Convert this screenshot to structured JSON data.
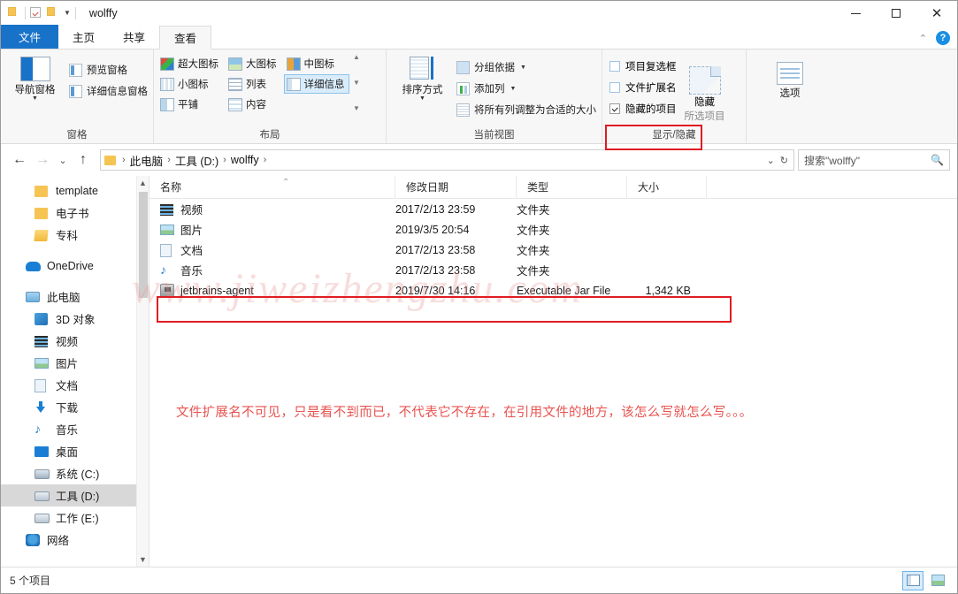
{
  "window": {
    "title": "wolffy",
    "quick_access": [
      "folder-icon",
      "checkbox-icon",
      "folder-icon",
      "dropdown-caret"
    ],
    "minimize": "minimize-icon",
    "maximize": "maximize-icon",
    "close": "close-icon"
  },
  "tabs": [
    {
      "label": "文件",
      "kind": "file"
    },
    {
      "label": "主页",
      "kind": "normal"
    },
    {
      "label": "共享",
      "kind": "normal"
    },
    {
      "label": "查看",
      "kind": "active"
    }
  ],
  "tab_right": {
    "collapse": "⌃",
    "help": "?"
  },
  "ribbon": {
    "groups": [
      {
        "label": "窗格",
        "big_button": {
          "label": "导航窗格",
          "has_dropdown": true
        },
        "items": [
          {
            "label": "预览窗格"
          },
          {
            "label": "详细信息窗格"
          }
        ]
      },
      {
        "label": "布局",
        "views": [
          {
            "label": "超大图标",
            "selected": false
          },
          {
            "label": "大图标",
            "selected": false
          },
          {
            "label": "中图标",
            "selected": false
          },
          {
            "label": "小图标",
            "selected": false
          },
          {
            "label": "列表",
            "selected": false
          },
          {
            "label": "详细信息",
            "selected": true
          },
          {
            "label": "平铺",
            "selected": false
          },
          {
            "label": "内容",
            "selected": false
          }
        ]
      },
      {
        "label": "当前视图",
        "big_button": {
          "label": "排序方式",
          "has_dropdown": true
        },
        "items": [
          {
            "label": "分组依据",
            "has_dropdown": true
          },
          {
            "label": "添加列",
            "has_dropdown": true
          },
          {
            "label": "将所有列调整为合适的大小",
            "has_dropdown": false
          }
        ]
      },
      {
        "label": "显示/隐藏",
        "checkboxes": [
          {
            "label": "项目复选框",
            "checked": false,
            "highlighted": false
          },
          {
            "label": "文件扩展名",
            "checked": false,
            "highlighted": true
          },
          {
            "label": "隐藏的项目",
            "checked": true,
            "highlighted": false
          }
        ],
        "hide_button": {
          "line1": "隐藏",
          "line2": "所选项目"
        }
      },
      {
        "label": "",
        "options_button": {
          "label": "选项"
        }
      }
    ]
  },
  "address_bar": {
    "back": "←",
    "forward": "→",
    "history": "⌄",
    "up": "↑",
    "breadcrumb": [
      {
        "text": "此电脑"
      },
      {
        "text": "工具 (D:)"
      },
      {
        "text": "wolffy"
      }
    ],
    "dropdown": "⌄",
    "refresh": "↻",
    "search_placeholder": "搜索\"wolffy\"",
    "search_value": "",
    "search_icon": "search-icon"
  },
  "sidebar": {
    "items": [
      {
        "label": "template",
        "icon": "folder-icon",
        "level": 2,
        "selected": false
      },
      {
        "label": "电子书",
        "icon": "folder-icon",
        "level": 2,
        "selected": false
      },
      {
        "label": "专科",
        "icon": "folder-open-icon",
        "level": 2,
        "selected": false
      },
      {
        "label": "",
        "icon": "spacer",
        "level": 0,
        "selected": false
      },
      {
        "label": "OneDrive",
        "icon": "cloud-icon",
        "level": 1,
        "selected": false
      },
      {
        "label": "",
        "icon": "spacer",
        "level": 0,
        "selected": false
      },
      {
        "label": "此电脑",
        "icon": "this-pc-icon",
        "level": 1,
        "selected": false
      },
      {
        "label": "3D 对象",
        "icon": "3d-objects-icon",
        "level": 2,
        "selected": false
      },
      {
        "label": "视频",
        "icon": "video-icon",
        "level": 2,
        "selected": false
      },
      {
        "label": "图片",
        "icon": "picture-icon",
        "level": 2,
        "selected": false
      },
      {
        "label": "文档",
        "icon": "document-icon",
        "level": 2,
        "selected": false
      },
      {
        "label": "下载",
        "icon": "download-icon",
        "level": 2,
        "selected": false
      },
      {
        "label": "音乐",
        "icon": "music-icon",
        "level": 2,
        "selected": false
      },
      {
        "label": "桌面",
        "icon": "desktop-icon",
        "level": 2,
        "selected": false
      },
      {
        "label": "系统 (C:)",
        "icon": "drive-icon",
        "level": 2,
        "selected": false
      },
      {
        "label": "工具 (D:)",
        "icon": "drive-icon",
        "level": 2,
        "selected": true
      },
      {
        "label": "工作 (E:)",
        "icon": "drive-icon",
        "level": 2,
        "selected": false
      },
      {
        "label": "网络",
        "icon": "network-icon",
        "level": 1,
        "selected": false
      }
    ]
  },
  "file_list": {
    "columns": [
      {
        "label": "名称",
        "key": "name"
      },
      {
        "label": "修改日期",
        "key": "date"
      },
      {
        "label": "类型",
        "key": "type"
      },
      {
        "label": "大小",
        "key": "size"
      }
    ],
    "sort_indicator": "⌃",
    "rows": [
      {
        "name": "视频",
        "date": "2017/2/13 23:59",
        "type": "文件夹",
        "size": "",
        "icon": "video-icon",
        "highlighted": false
      },
      {
        "name": "图片",
        "date": "2019/3/5 20:54",
        "type": "文件夹",
        "size": "",
        "icon": "picture-icon",
        "highlighted": false
      },
      {
        "name": "文档",
        "date": "2017/2/13 23:58",
        "type": "文件夹",
        "size": "",
        "icon": "document-icon",
        "highlighted": false
      },
      {
        "name": "音乐",
        "date": "2017/2/13 23:58",
        "type": "文件夹",
        "size": "",
        "icon": "music-icon",
        "highlighted": false
      },
      {
        "name": "jetbrains-agent",
        "date": "2019/7/30 14:16",
        "type": "Executable Jar File",
        "size": "1,342 KB",
        "icon": "jar-file-icon",
        "highlighted": true
      }
    ]
  },
  "annotation": {
    "text": "文件扩展名不可见，只是看不到而已，不代表它不存在，在引用文件的地方，该怎么写就怎么写。。。",
    "color": "#e8534f"
  },
  "watermark": {
    "text": "www.jiweizhengzhu.com"
  },
  "status_bar": {
    "item_count": "5 个项目",
    "views": [
      {
        "name": "details-view-button",
        "selected": true
      },
      {
        "name": "large-icons-view-button",
        "selected": false
      }
    ]
  },
  "colors": {
    "accent": "#1872c8",
    "highlight_box": "#e11b22",
    "selected_row": "#d8d8d8",
    "annotation": "#e8534f"
  }
}
